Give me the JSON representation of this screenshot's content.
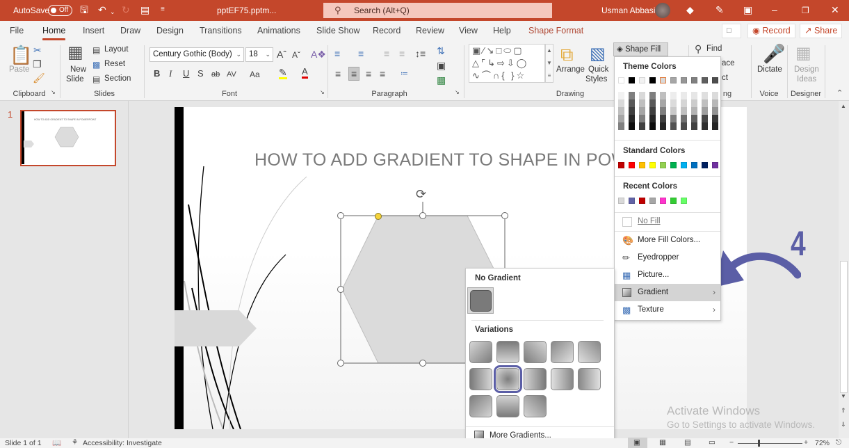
{
  "titlebar": {
    "autosave_label": "AutoSave",
    "autosave_state": "Off",
    "filename": "pptEF75.pptm...",
    "search_placeholder": "Search (Alt+Q)",
    "user_name": "Usman Abbasi",
    "icons": [
      "save-icon",
      "undo-icon",
      "redo-icon",
      "present-icon",
      "customize-qat-icon",
      "diamond-icon",
      "pen-icon",
      "ribbon-display-icon",
      "minimize-icon",
      "restore-icon",
      "close-icon"
    ]
  },
  "tabs": [
    {
      "label": "File"
    },
    {
      "label": "Home",
      "active": true
    },
    {
      "label": "Insert"
    },
    {
      "label": "Draw"
    },
    {
      "label": "Design"
    },
    {
      "label": "Transitions"
    },
    {
      "label": "Animations"
    },
    {
      "label": "Slide Show"
    },
    {
      "label": "Record"
    },
    {
      "label": "Review"
    },
    {
      "label": "View"
    },
    {
      "label": "Help"
    },
    {
      "label": "Shape Format"
    }
  ],
  "top_right": {
    "record_label": "Record",
    "share_label": "Share"
  },
  "ribbon": {
    "clipboard": {
      "paste": "Paste",
      "group": "Clipboard"
    },
    "slides": {
      "new_slide_1": "New",
      "new_slide_2": "Slide",
      "layout": "Layout",
      "reset": "Reset",
      "section": "Section",
      "group": "Slides"
    },
    "font": {
      "font_name": "Century Gothic (Body)",
      "font_size": "18",
      "bold": "B",
      "italic": "I",
      "underline": "U",
      "shadow": "S",
      "strike": "ab",
      "spacing": "AV",
      "case": "Aa",
      "group": "Font"
    },
    "paragraph": {
      "group": "Paragraph"
    },
    "drawing": {
      "arrange": "Arrange",
      "quick_styles_1": "Quick",
      "quick_styles_2": "Styles",
      "group": "Drawing",
      "shape_fill": "Shape Fill"
    },
    "editing": {
      "find": "Find",
      "replace_partial": "ace",
      "select_partial": "ct",
      "group_partial": "ng"
    },
    "voice": {
      "dictate": "Dictate",
      "group": "Voice"
    },
    "designer": {
      "ideas_1": "Design",
      "ideas_2": "Ideas",
      "group": "Designer"
    }
  },
  "thumbnails": [
    {
      "number": "1",
      "title": "HOW TO ADD GRADIENT TO SHAPE IN POWERPOINT"
    }
  ],
  "slide": {
    "title": "HOW TO ADD GRADIENT TO SHAPE IN POWERPOINT"
  },
  "shape_fill_menu": {
    "theme_header": "Theme Colors",
    "theme_top": [
      "#ffffff",
      "#000000",
      "#f2f2f2",
      "#000000",
      "#d9d9d9",
      "#a6a6a6",
      "#969696",
      "#808080",
      "#5f5f5f",
      "#4d4d4d"
    ],
    "theme_shades": [
      [
        "#f2f2f2",
        "#d9d9d9",
        "#bfbfbf",
        "#a6a6a6",
        "#808080"
      ],
      [
        "#7f7f7f",
        "#595959",
        "#3f3f3f",
        "#262626",
        "#0d0d0d"
      ],
      [
        "#d9d9d9",
        "#bfbfbf",
        "#a6a6a6",
        "#808080",
        "#404040"
      ],
      [
        "#7f7f7f",
        "#595959",
        "#3f3f3f",
        "#262626",
        "#0d0d0d"
      ],
      [
        "#bfbfbf",
        "#a6a6a6",
        "#7f7f7f",
        "#404040",
        "#262626"
      ],
      [
        "#ededed",
        "#dbdbdb",
        "#c9c9c9",
        "#7f7f7f",
        "#525252"
      ],
      [
        "#eaeaea",
        "#d5d5d5",
        "#c0c0c0",
        "#707070",
        "#4b4b4b"
      ],
      [
        "#e6e6e6",
        "#cccccc",
        "#b3b3b3",
        "#606060",
        "#404040"
      ],
      [
        "#dfdfdf",
        "#bfbfbf",
        "#9f9f9f",
        "#474747",
        "#2f2f2f"
      ],
      [
        "#dbdbdb",
        "#b8b8b8",
        "#949494",
        "#3a3a3a",
        "#262626"
      ]
    ],
    "selected_theme_index": 4,
    "standard_header": "Standard Colors",
    "standard": [
      "#c00000",
      "#ff0000",
      "#ffc000",
      "#ffff00",
      "#92d050",
      "#00b050",
      "#00b0f0",
      "#0070c0",
      "#002060",
      "#7030a0"
    ],
    "recent_header": "Recent Colors",
    "recent": [
      "#d9d9d9",
      "#6264a7",
      "#c00000",
      "#a6a6a6",
      "#ff33cc",
      "#33cc33",
      "#66ff66"
    ],
    "items": [
      {
        "label": "No Fill",
        "icon": "no-fill-icon"
      },
      {
        "label": "More Fill Colors...",
        "icon": "palette-icon"
      },
      {
        "label": "Eyedropper",
        "icon": "eyedropper-icon"
      },
      {
        "label": "Picture...",
        "icon": "picture-icon"
      },
      {
        "label": "Gradient",
        "icon": "gradient-icon",
        "submenu": true,
        "highlighted": true
      },
      {
        "label": "Texture",
        "icon": "texture-icon",
        "submenu": true
      }
    ]
  },
  "gradient_menu": {
    "no_gradient_header": "No Gradient",
    "variations_header": "Variations",
    "variations_count": 13,
    "selected_variation_index": 6,
    "more_gradients": "More Gradients..."
  },
  "annotation": {
    "step_number": "4",
    "color": "#5b5ea6"
  },
  "status": {
    "slide_info": "Slide 1 of 1",
    "accessibility": "Accessibility: Investigate",
    "zoom": "72%"
  },
  "watermark": {
    "line1": "Activate Windows",
    "line2": "Go to Settings to activate Windows."
  }
}
